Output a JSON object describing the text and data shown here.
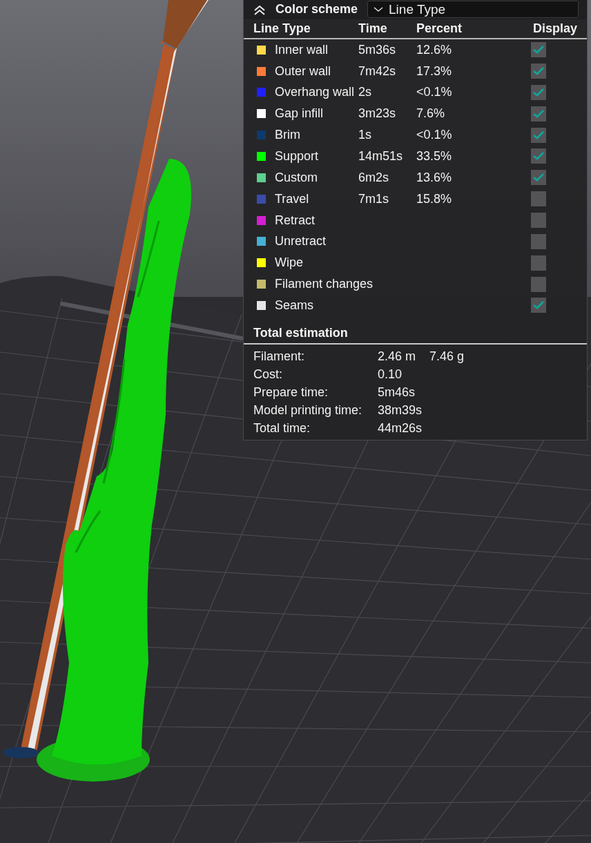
{
  "legend_panel": {
    "title": "Color scheme",
    "scheme_dropdown": {
      "value": "Line Type"
    },
    "columns": [
      "Line Type",
      "Time",
      "Percent",
      "Display"
    ],
    "rows": [
      {
        "name": "Inner wall",
        "time": "5m36s",
        "percent": "12.6%",
        "color": "#ffd94a",
        "checked": true
      },
      {
        "name": "Outer wall",
        "time": "7m42s",
        "percent": "17.3%",
        "color": "#ff7a3a",
        "checked": true
      },
      {
        "name": "Overhang wall",
        "time": "2s",
        "percent": "<0.1%",
        "color": "#2020ff",
        "checked": true
      },
      {
        "name": "Gap infill",
        "time": "3m23s",
        "percent": "7.6%",
        "color": "#ffffff",
        "checked": true
      },
      {
        "name": "Brim",
        "time": "1s",
        "percent": "<0.1%",
        "color": "#0b3a6e",
        "checked": true
      },
      {
        "name": "Support",
        "time": "14m51s",
        "percent": "33.5%",
        "color": "#00ff00",
        "checked": true
      },
      {
        "name": "Custom",
        "time": "6m2s",
        "percent": "13.6%",
        "color": "#5ecf8e",
        "checked": true
      },
      {
        "name": "Travel",
        "time": "7m1s",
        "percent": "15.8%",
        "color": "#3a4ca8",
        "checked": false
      },
      {
        "name": "Retract",
        "color": "#d41fd4",
        "checked": false
      },
      {
        "name": "Unretract",
        "color": "#45b0d4",
        "checked": false
      },
      {
        "name": "Wipe",
        "color": "#ffff00",
        "checked": false
      },
      {
        "name": "Filament changes",
        "color": "#c4bc6a",
        "checked": false
      },
      {
        "name": "Seams",
        "color": "#e6e6e6",
        "checked": true
      }
    ],
    "estimation": {
      "title": "Total estimation",
      "items": [
        {
          "label": "Filament:",
          "values": [
            "2.46 m",
            "7.46 g"
          ]
        },
        {
          "label": "Cost:",
          "values": [
            "0.10"
          ]
        },
        {
          "label": "Prepare time:",
          "values": [
            "5m46s"
          ]
        },
        {
          "label": "Model printing time:",
          "values": [
            "38m39s"
          ]
        },
        {
          "label": "Total time:",
          "values": [
            "44m26s"
          ]
        }
      ]
    }
  }
}
